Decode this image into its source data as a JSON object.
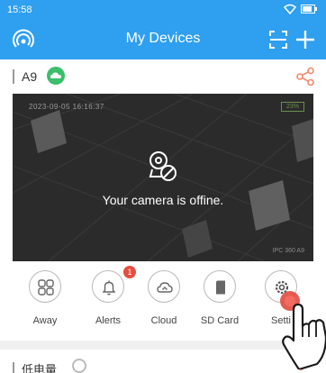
{
  "status_bar": {
    "time": "15:58"
  },
  "header": {
    "title": "My Devices"
  },
  "device": {
    "name": "A9"
  },
  "camera": {
    "overlay_top": "2023-09-05  16:16:37",
    "battery": "23%",
    "offline_message": "Your camera is offine.",
    "overlay_bottom": "IPC  360  A9"
  },
  "controls": [
    {
      "label": "Away",
      "icon": "away-icon"
    },
    {
      "label": "Alerts",
      "icon": "bell-icon",
      "badge": "1"
    },
    {
      "label": "Cloud",
      "icon": "cloud-icon"
    },
    {
      "label": "SD Card",
      "icon": "sd-card-icon"
    },
    {
      "label": "Setti",
      "icon": "gear-icon"
    }
  ],
  "next_device": {
    "name": "低电量"
  },
  "colors": {
    "header_bg": "#2f9ff0",
    "accent_green": "#3bbf6a",
    "share_orange": "#f08a6a",
    "badge_red": "#e84c3d"
  }
}
